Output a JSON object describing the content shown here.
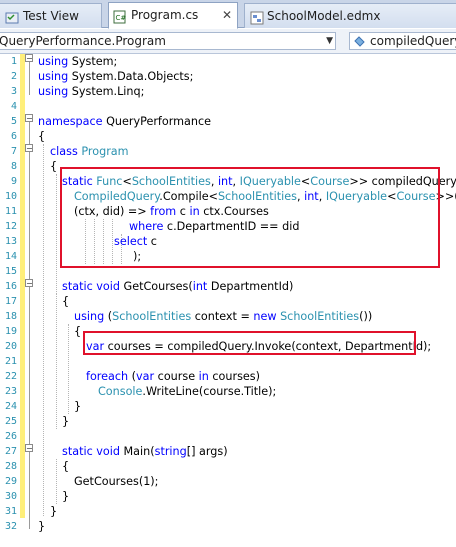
{
  "tabs": [
    {
      "label": "Test View",
      "state": "inactive",
      "icon": "test-view-icon"
    },
    {
      "label": "Program.cs",
      "state": "active",
      "icon": "csharp-file-icon"
    },
    {
      "label": "SchoolModel.edmx",
      "state": "inactive",
      "icon": "edmx-file-icon"
    }
  ],
  "navbar": {
    "type_selector": "QueryPerformance.Program",
    "member_selector": "compiledQuery"
  },
  "colors": {
    "keyword": "#0000ff",
    "type": "#2b91af",
    "line_number": "#2b91af",
    "highlight_box": "#e0112b",
    "change_bar": "#ffef7a"
  },
  "line_numbers": [
    "1",
    "2",
    "3",
    "4",
    "5",
    "6",
    "7",
    "8",
    "9",
    "10",
    "11",
    "12",
    "13",
    "14",
    "15",
    "16",
    "17",
    "18",
    "19",
    "20",
    "21",
    "22",
    "23",
    "24",
    "25",
    "26",
    "27",
    "28",
    "29",
    "30",
    "31",
    "32"
  ],
  "code": [
    [
      {
        "k": "kw",
        "t": "using"
      },
      {
        "k": "",
        "t": " System;"
      }
    ],
    [
      {
        "k": "kw",
        "t": "using"
      },
      {
        "k": "",
        "t": " System.Data.Objects;"
      }
    ],
    [
      {
        "k": "kw",
        "t": "using"
      },
      {
        "k": "",
        "t": " System.Linq;"
      }
    ],
    [],
    [
      {
        "k": "kw",
        "t": "namespace"
      },
      {
        "k": "",
        "t": " QueryPerformance"
      }
    ],
    [
      {
        "k": "",
        "t": "{"
      }
    ],
    [
      {
        "k": "kw",
        "t": "class"
      },
      {
        "k": "",
        "t": " "
      },
      {
        "k": "ty",
        "t": "Program"
      }
    ],
    [
      {
        "k": "",
        "t": "{"
      }
    ],
    [
      {
        "k": "kw",
        "t": "static"
      },
      {
        "k": "",
        "t": " "
      },
      {
        "k": "ty",
        "t": "Func"
      },
      {
        "k": "",
        "t": "<"
      },
      {
        "k": "ty",
        "t": "SchoolEntities"
      },
      {
        "k": "",
        "t": ", "
      },
      {
        "k": "kw",
        "t": "int"
      },
      {
        "k": "",
        "t": ", "
      },
      {
        "k": "ty",
        "t": "IQueryable"
      },
      {
        "k": "",
        "t": "<"
      },
      {
        "k": "ty",
        "t": "Course"
      },
      {
        "k": "",
        "t": ">> compiledQuery ="
      }
    ],
    [
      {
        "k": "ty",
        "t": "CompiledQuery"
      },
      {
        "k": "",
        "t": ".Compile<"
      },
      {
        "k": "ty",
        "t": "SchoolEntities"
      },
      {
        "k": "",
        "t": ", "
      },
      {
        "k": "kw",
        "t": "int"
      },
      {
        "k": "",
        "t": ", "
      },
      {
        "k": "ty",
        "t": "IQueryable"
      },
      {
        "k": "",
        "t": "<"
      },
      {
        "k": "ty",
        "t": "Course"
      },
      {
        "k": "",
        "t": ">>("
      }
    ],
    [
      {
        "k": "",
        "t": "(ctx, did) => "
      },
      {
        "k": "kw",
        "t": "from"
      },
      {
        "k": "",
        "t": " c "
      },
      {
        "k": "kw",
        "t": "in"
      },
      {
        "k": "",
        "t": " ctx.Courses"
      }
    ],
    [
      {
        "k": "kw",
        "t": "where"
      },
      {
        "k": "",
        "t": " c.DepartmentID == did"
      }
    ],
    [
      {
        "k": "kw",
        "t": "select"
      },
      {
        "k": "",
        "t": " c"
      }
    ],
    [
      {
        "k": "",
        "t": ");"
      }
    ],
    [],
    [
      {
        "k": "kw",
        "t": "static"
      },
      {
        "k": "",
        "t": " "
      },
      {
        "k": "kw",
        "t": "void"
      },
      {
        "k": "",
        "t": " GetCourses("
      },
      {
        "k": "kw",
        "t": "int"
      },
      {
        "k": "",
        "t": " DepartmentId)"
      }
    ],
    [
      {
        "k": "",
        "t": "{"
      }
    ],
    [
      {
        "k": "kw",
        "t": "using"
      },
      {
        "k": "",
        "t": " ("
      },
      {
        "k": "ty",
        "t": "SchoolEntities"
      },
      {
        "k": "",
        "t": " context = "
      },
      {
        "k": "kw",
        "t": "new"
      },
      {
        "k": "",
        "t": " "
      },
      {
        "k": "ty",
        "t": "SchoolEntities"
      },
      {
        "k": "",
        "t": "())"
      }
    ],
    [
      {
        "k": "",
        "t": "{"
      }
    ],
    [
      {
        "k": "kw",
        "t": "var"
      },
      {
        "k": "",
        "t": " courses = compiledQuery.Invoke(context, DepartmentId);"
      }
    ],
    [],
    [
      {
        "k": "kw",
        "t": "foreach"
      },
      {
        "k": "",
        "t": " ("
      },
      {
        "k": "kw",
        "t": "var"
      },
      {
        "k": "",
        "t": " course "
      },
      {
        "k": "kw",
        "t": "in"
      },
      {
        "k": "",
        "t": " courses)"
      }
    ],
    [
      {
        "k": "ty",
        "t": "Console"
      },
      {
        "k": "",
        "t": ".WriteLine(course.Title);"
      }
    ],
    [
      {
        "k": "",
        "t": "}"
      }
    ],
    [
      {
        "k": "",
        "t": "}"
      }
    ],
    [],
    [
      {
        "k": "kw",
        "t": "static"
      },
      {
        "k": "",
        "t": " "
      },
      {
        "k": "kw",
        "t": "void"
      },
      {
        "k": "",
        "t": " Main("
      },
      {
        "k": "kw",
        "t": "string"
      },
      {
        "k": "",
        "t": "[] args)"
      }
    ],
    [
      {
        "k": "",
        "t": "{"
      }
    ],
    [
      {
        "k": "",
        "t": "GetCourses(1);"
      }
    ],
    [
      {
        "k": "",
        "t": "}"
      }
    ],
    [
      {
        "k": "",
        "t": "}"
      }
    ],
    [
      {
        "k": "",
        "t": "}"
      }
    ]
  ]
}
